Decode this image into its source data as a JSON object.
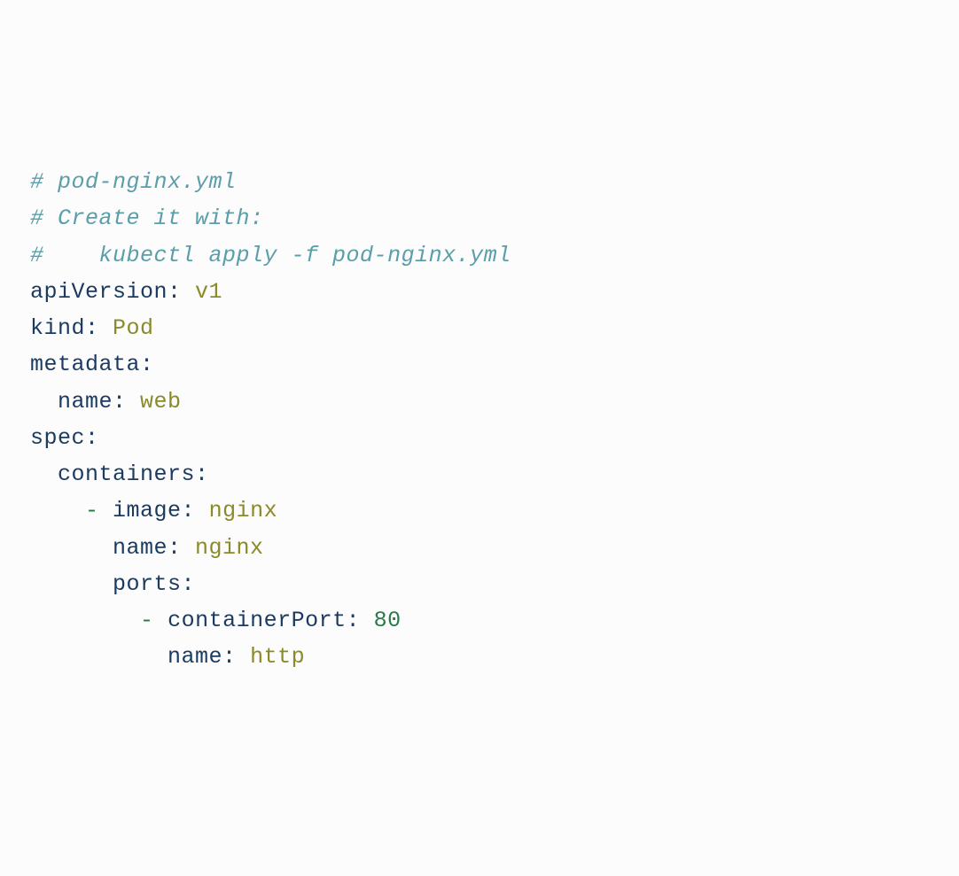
{
  "lines": [
    {
      "tokens": [
        {
          "cls": "comment",
          "text": "# pod-nginx.yml"
        }
      ]
    },
    {
      "tokens": [
        {
          "cls": "comment",
          "text": "# Create it with:"
        }
      ]
    },
    {
      "tokens": [
        {
          "cls": "comment",
          "text": "#    kubectl apply -f pod-nginx.yml"
        }
      ]
    },
    {
      "tokens": [
        {
          "cls": "key",
          "text": "apiVersion:"
        },
        {
          "cls": "",
          "text": " "
        },
        {
          "cls": "value",
          "text": "v1"
        }
      ]
    },
    {
      "tokens": [
        {
          "cls": "key",
          "text": "kind:"
        },
        {
          "cls": "",
          "text": " "
        },
        {
          "cls": "value",
          "text": "Pod"
        }
      ]
    },
    {
      "tokens": [
        {
          "cls": "key",
          "text": "metadata:"
        }
      ]
    },
    {
      "tokens": [
        {
          "cls": "",
          "text": "  "
        },
        {
          "cls": "key",
          "text": "name:"
        },
        {
          "cls": "",
          "text": " "
        },
        {
          "cls": "value",
          "text": "web"
        }
      ]
    },
    {
      "tokens": [
        {
          "cls": "key",
          "text": "spec:"
        }
      ]
    },
    {
      "tokens": [
        {
          "cls": "",
          "text": "  "
        },
        {
          "cls": "key",
          "text": "containers:"
        }
      ]
    },
    {
      "tokens": [
        {
          "cls": "",
          "text": "    "
        },
        {
          "cls": "dash",
          "text": "-"
        },
        {
          "cls": "",
          "text": " "
        },
        {
          "cls": "key",
          "text": "image:"
        },
        {
          "cls": "",
          "text": " "
        },
        {
          "cls": "value",
          "text": "nginx"
        }
      ]
    },
    {
      "tokens": [
        {
          "cls": "",
          "text": "      "
        },
        {
          "cls": "key",
          "text": "name:"
        },
        {
          "cls": "",
          "text": " "
        },
        {
          "cls": "value",
          "text": "nginx"
        }
      ]
    },
    {
      "tokens": [
        {
          "cls": "",
          "text": "      "
        },
        {
          "cls": "key",
          "text": "ports:"
        }
      ]
    },
    {
      "tokens": [
        {
          "cls": "",
          "text": "        "
        },
        {
          "cls": "dash",
          "text": "-"
        },
        {
          "cls": "",
          "text": " "
        },
        {
          "cls": "key",
          "text": "containerPort:"
        },
        {
          "cls": "",
          "text": " "
        },
        {
          "cls": "number",
          "text": "80"
        }
      ]
    },
    {
      "tokens": [
        {
          "cls": "",
          "text": "          "
        },
        {
          "cls": "key",
          "text": "name:"
        },
        {
          "cls": "",
          "text": " "
        },
        {
          "cls": "value",
          "text": "http"
        }
      ]
    }
  ]
}
